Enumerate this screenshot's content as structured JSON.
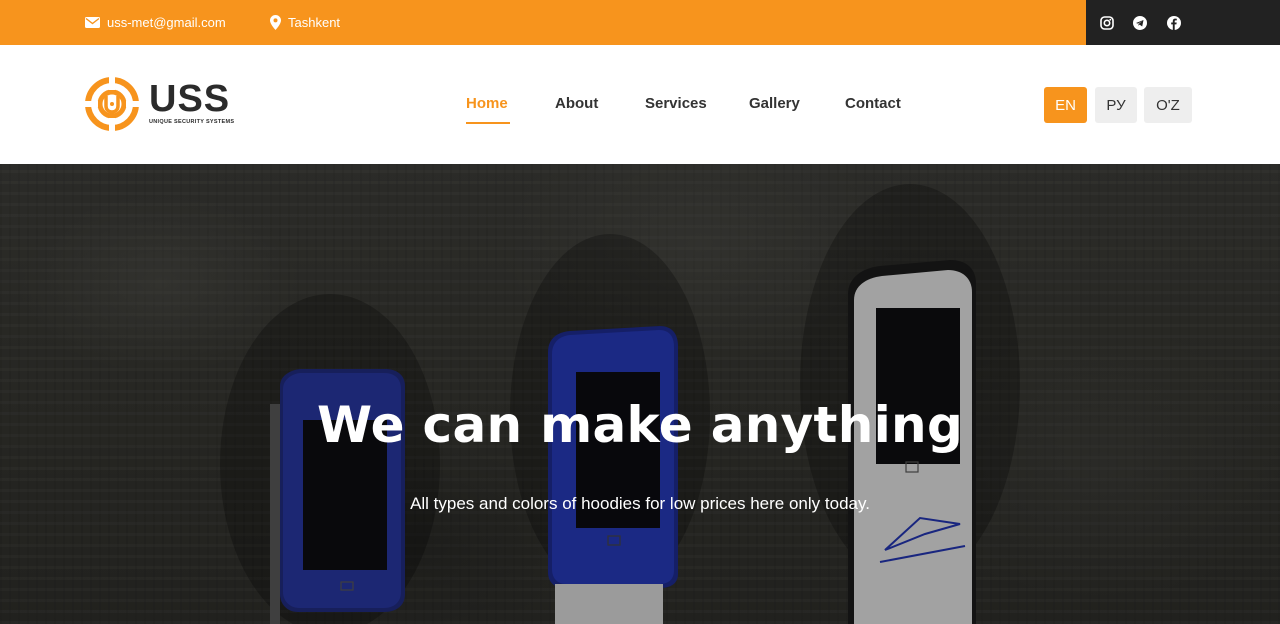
{
  "topbar": {
    "email": "uss-met@gmail.com",
    "location": "Tashkent",
    "social": [
      "instagram-icon",
      "telegram-icon",
      "facebook-icon"
    ]
  },
  "logo": {
    "name": "USS",
    "tagline": "UNIQUE SECURITY SYSTEMS"
  },
  "nav": {
    "items": [
      {
        "label": "Home",
        "active": true
      },
      {
        "label": "About",
        "active": false
      },
      {
        "label": "Services",
        "active": false
      },
      {
        "label": "Gallery",
        "active": false
      },
      {
        "label": "Contact",
        "active": false
      }
    ]
  },
  "languages": [
    {
      "label": "EN",
      "active": true
    },
    {
      "label": "РУ",
      "active": false
    },
    {
      "label": "O'Z",
      "active": false
    }
  ],
  "hero": {
    "title": "We can make anything",
    "subtitle": "All types and colors of hoodies for low prices here only today."
  },
  "colors": {
    "accent": "#f7941d",
    "dark": "#222222",
    "text": "#333333"
  }
}
